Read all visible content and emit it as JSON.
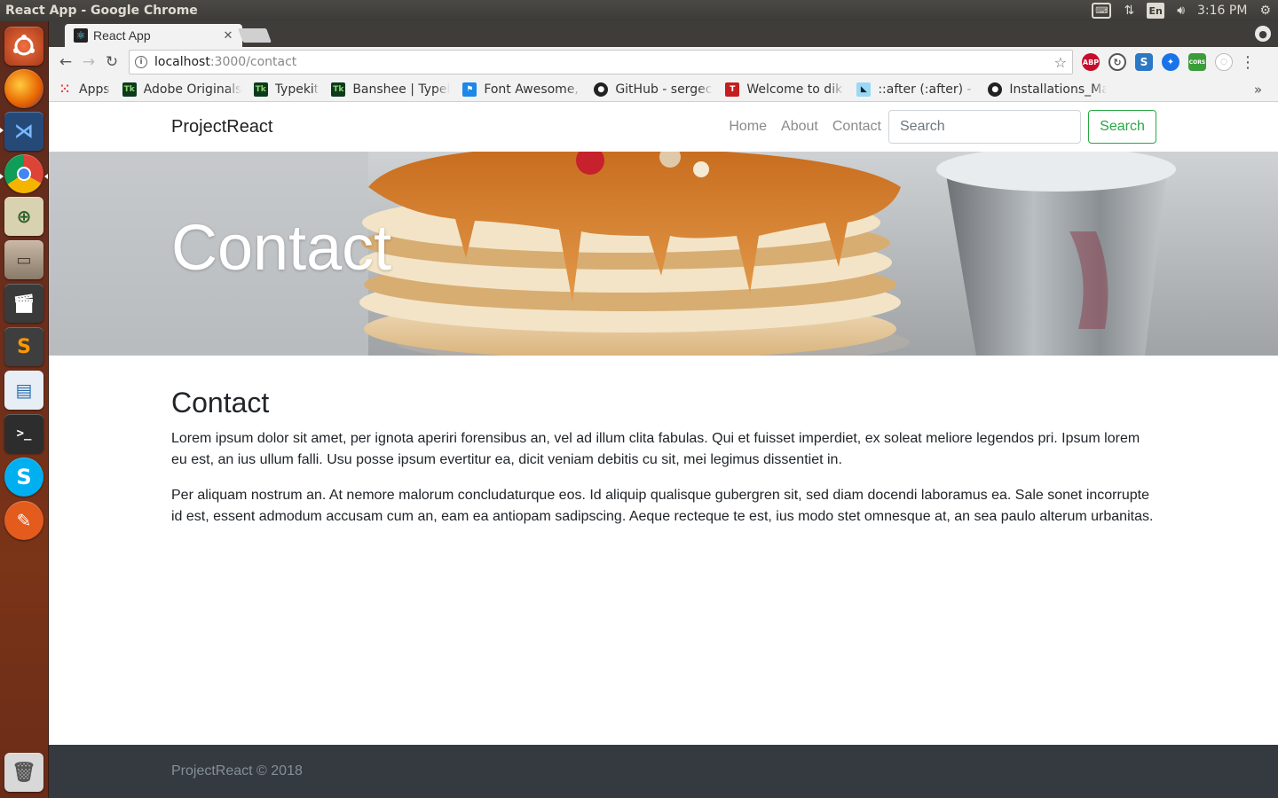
{
  "system": {
    "window_title": "React App - Google Chrome",
    "keyboard_layout": "En",
    "clock": "3:16 PM"
  },
  "launcher": {
    "items": [
      {
        "name": "ubuntu-dash",
        "color": "#c8502a"
      },
      {
        "name": "firefox",
        "color": "#e66000"
      },
      {
        "name": "vscode",
        "color": "#1e5fa3"
      },
      {
        "name": "chrome",
        "color": "#4a90d9"
      },
      {
        "name": "system-monitor",
        "color": "#6b8e23"
      },
      {
        "name": "files",
        "color": "#8a7a6a"
      },
      {
        "name": "video-editor",
        "color": "#444444"
      },
      {
        "name": "sublime-text",
        "color": "#4a4a4a"
      },
      {
        "name": "libreoffice-writer",
        "color": "#2a6fb0"
      },
      {
        "name": "terminal",
        "color": "#2d2d2d"
      },
      {
        "name": "skype",
        "color": "#00aff0"
      },
      {
        "name": "pencil",
        "color": "#e35b1d"
      },
      {
        "name": "trash",
        "color": "#7a7a7a"
      }
    ]
  },
  "browser": {
    "tab_title": "React App",
    "url_host": "localhost",
    "url_path": ":3000/contact",
    "bookmarks": [
      {
        "label": "Apps",
        "icon": "apps-grid-icon"
      },
      {
        "label": "Adobe Originals",
        "icon": "typekit-icon"
      },
      {
        "label": "Typekit",
        "icon": "typekit-icon"
      },
      {
        "label": "Banshee | Typekit",
        "icon": "typekit-icon"
      },
      {
        "label": "Font Awesome, t",
        "icon": "flag-icon"
      },
      {
        "label": "GitHub - sergech",
        "icon": "github-icon"
      },
      {
        "label": "Welcome to diks",
        "icon": "bookmark-icon"
      },
      {
        "label": "::after (:after) - C",
        "icon": "mdn-icon"
      },
      {
        "label": "Installations_Ma",
        "icon": "github-icon"
      }
    ],
    "extensions": [
      {
        "label": "ABP",
        "color": "#c70d2c"
      },
      {
        "label": "",
        "color": "#555555"
      },
      {
        "label": "S",
        "color": "#2b78c5"
      },
      {
        "label": "",
        "color": "#1a73e8"
      },
      {
        "label": "CORS",
        "color": "#3a9d3a"
      },
      {
        "label": "",
        "color": "#cccccc"
      }
    ]
  },
  "page": {
    "brand": "ProjectReact",
    "nav": [
      "Home",
      "About",
      "Contact"
    ],
    "search_placeholder": "Search",
    "search_button": "Search",
    "hero_title": "Contact",
    "heading": "Contact",
    "paragraphs": [
      "Lorem ipsum dolor sit amet, per ignota aperiri forensibus an, vel ad illum clita fabulas. Qui et fuisset imperdiet, ex soleat meliore legendos pri. Ipsum lorem eu est, an ius ullum falli. Usu posse ipsum evertitur ea, dicit veniam debitis cu sit, mei legimus dissentiet in.",
      "Per aliquam nostrum an. At nemore malorum concludaturque eos. Id aliquip qualisque gubergren sit, sed diam docendi laboramus ea. Sale sonet incorrupte id est, essent admodum accusam cum an, eam ea antiopam sadipscing. Aeque recteque te est, ius modo stet omnesque at, an sea paulo alterum urbanitas."
    ],
    "footer": "ProjectReact © 2018"
  }
}
